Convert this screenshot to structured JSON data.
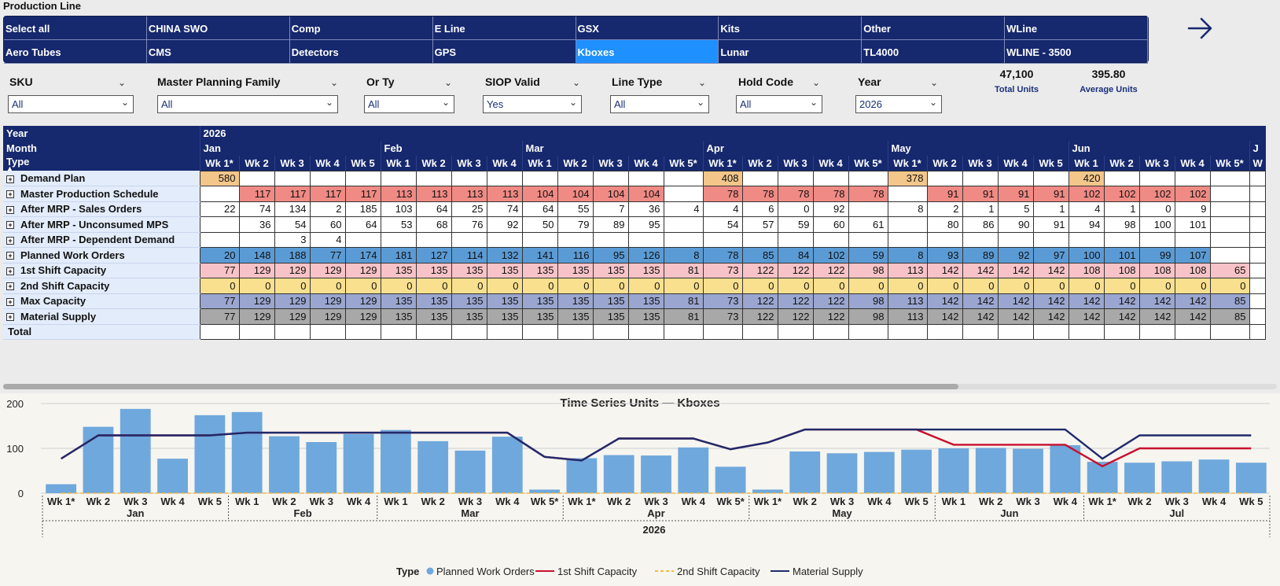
{
  "production_line": {
    "title": "Production Line",
    "tiles": [
      "Select all",
      "CHINA SWO",
      "Comp",
      "E Line",
      "GSX",
      "Kits",
      "Other",
      "WLine",
      "Aero Tubes",
      "CMS",
      "Detectors",
      "GPS",
      "Kboxes",
      "Lunar",
      "TL4000",
      "WLINE - 3500"
    ],
    "selected": "Kboxes"
  },
  "filters": [
    {
      "label": "SKU",
      "value": "All"
    },
    {
      "label": "Master Planning Family",
      "value": "All"
    },
    {
      "label": "Or Ty",
      "value": "All"
    },
    {
      "label": "SIOP Valid",
      "value": "Yes"
    },
    {
      "label": "Line Type",
      "value": "All"
    },
    {
      "label": "Hold Code",
      "value": "All"
    },
    {
      "label": "Year",
      "value": "2026"
    }
  ],
  "kpis": [
    {
      "value": "47,100",
      "label": "Total Units"
    },
    {
      "value": "395.80",
      "label": "Average Units"
    }
  ],
  "matrix": {
    "year_label": "Year",
    "month_label": "Month",
    "type_label": "Type",
    "sort_indicator": "▲",
    "year": "2026",
    "months": [
      {
        "name": "Jan",
        "span": 5
      },
      {
        "name": "Feb",
        "span": 4
      },
      {
        "name": "Mar",
        "span": 5
      },
      {
        "name": "Apr",
        "span": 5
      },
      {
        "name": "May",
        "span": 5
      },
      {
        "name": "Jun",
        "span": 5
      },
      {
        "name": "J",
        "span": 1
      }
    ],
    "weeks": [
      "Wk 1*",
      "Wk 2",
      "Wk 3",
      "Wk 4",
      "Wk 5",
      "Wk 1",
      "Wk 2",
      "Wk 3",
      "Wk 4",
      "Wk 1",
      "Wk 2",
      "Wk 3",
      "Wk 4",
      "Wk 5*",
      "Wk 1*",
      "Wk 2",
      "Wk 3",
      "Wk 4",
      "Wk 5*",
      "Wk 1*",
      "Wk 2",
      "Wk 3",
      "Wk 4",
      "Wk 5",
      "Wk 1",
      "Wk 2",
      "Wk 3",
      "Wk 4",
      "Wk 5*",
      "W"
    ],
    "rows": [
      {
        "label": "Demand Plan",
        "bg": "#f3c68a",
        "cells": [
          "580",
          "",
          "",
          "",
          "",
          "",
          "",
          "",
          "",
          "",
          "",
          "",
          "",
          "",
          "408",
          "",
          "",
          "",
          "",
          "378",
          "",
          "",
          "",
          "",
          "420",
          "",
          "",
          "",
          "",
          ""
        ]
      },
      {
        "label": "Master Production Schedule",
        "bg": "#f08a84",
        "cells": [
          "",
          "117",
          "117",
          "117",
          "117",
          "113",
          "113",
          "113",
          "113",
          "104",
          "104",
          "104",
          "104",
          "",
          "78",
          "78",
          "78",
          "78",
          "78",
          "",
          "91",
          "91",
          "91",
          "91",
          "102",
          "102",
          "102",
          "102",
          "",
          ""
        ]
      },
      {
        "label": "After MRP - Sales Orders",
        "bg": "",
        "cells": [
          "22",
          "74",
          "134",
          "2",
          "185",
          "103",
          "64",
          "25",
          "74",
          "64",
          "55",
          "7",
          "36",
          "4",
          "4",
          "6",
          "0",
          "92",
          "",
          "8",
          "2",
          "1",
          "5",
          "1",
          "4",
          "1",
          "0",
          "9",
          "",
          ""
        ]
      },
      {
        "label": "After MRP - Unconsumed MPS",
        "bg": "",
        "cells": [
          "",
          "36",
          "54",
          "60",
          "64",
          "53",
          "68",
          "76",
          "92",
          "50",
          "79",
          "89",
          "95",
          "",
          "54",
          "57",
          "59",
          "60",
          "61",
          "",
          "80",
          "86",
          "90",
          "91",
          "94",
          "98",
          "100",
          "101",
          "",
          ""
        ]
      },
      {
        "label": "After MRP - Dependent Demand",
        "bg": "",
        "cells": [
          "",
          "",
          "3",
          "4",
          "",
          "",
          "",
          "",
          "",
          "",
          "",
          "",
          "",
          "",
          "",
          "",
          "",
          "",
          "",
          "",
          "",
          "",
          "",
          "",
          "",
          "",
          "",
          "",
          "",
          ""
        ]
      },
      {
        "label": "Planned Work Orders",
        "bg": "#5b9bd5",
        "cells": [
          "20",
          "148",
          "188",
          "77",
          "174",
          "181",
          "127",
          "114",
          "132",
          "141",
          "116",
          "95",
          "126",
          "8",
          "78",
          "85",
          "84",
          "102",
          "59",
          "8",
          "93",
          "89",
          "92",
          "97",
          "100",
          "101",
          "99",
          "107",
          "",
          ""
        ]
      },
      {
        "label": "1st Shift Capacity",
        "bg": "#f8c3c8",
        "cells": [
          "77",
          "129",
          "129",
          "129",
          "129",
          "135",
          "135",
          "135",
          "135",
          "135",
          "135",
          "135",
          "135",
          "81",
          "73",
          "122",
          "122",
          "122",
          "98",
          "113",
          "142",
          "142",
          "142",
          "142",
          "108",
          "108",
          "108",
          "108",
          "65",
          ""
        ]
      },
      {
        "label": "2nd Shift Capacity",
        "bg": "#f9e08e",
        "cells": [
          "0",
          "0",
          "0",
          "0",
          "0",
          "0",
          "0",
          "0",
          "0",
          "0",
          "0",
          "0",
          "0",
          "0",
          "0",
          "0",
          "0",
          "0",
          "0",
          "0",
          "0",
          "0",
          "0",
          "0",
          "0",
          "0",
          "0",
          "0",
          "0",
          ""
        ]
      },
      {
        "label": "Max Capacity",
        "bg": "#9aa6cf",
        "cells": [
          "77",
          "129",
          "129",
          "129",
          "129",
          "135",
          "135",
          "135",
          "135",
          "135",
          "135",
          "135",
          "135",
          "81",
          "73",
          "122",
          "122",
          "122",
          "98",
          "113",
          "142",
          "142",
          "142",
          "142",
          "142",
          "142",
          "142",
          "142",
          "85",
          ""
        ]
      },
      {
        "label": "Material Supply",
        "bg": "#a8a8a8",
        "cells": [
          "77",
          "129",
          "129",
          "129",
          "129",
          "135",
          "135",
          "135",
          "135",
          "135",
          "135",
          "135",
          "135",
          "81",
          "73",
          "122",
          "122",
          "122",
          "98",
          "113",
          "142",
          "142",
          "142",
          "142",
          "142",
          "142",
          "142",
          "142",
          "85",
          ""
        ]
      },
      {
        "label": "Total",
        "bg": "",
        "total": true,
        "cells": [
          "",
          "",
          "",
          "",
          "",
          "",
          "",
          "",
          "",
          "",
          "",
          "",
          "",
          "",
          "",
          "",
          "",
          "",
          "",
          "",
          "",
          "",
          "",
          "",
          "",
          "",
          "",
          "",
          "",
          ""
        ]
      }
    ]
  },
  "chart_data": {
    "type": "bar",
    "title": "Time Series Units — Kboxes",
    "ylim": [
      0,
      215
    ],
    "yticks": [
      "0",
      "100",
      "200"
    ],
    "categories": [
      "Wk 1*",
      "Wk 2",
      "Wk 3",
      "Wk 4",
      "Wk 5",
      "Wk 1",
      "Wk 2",
      "Wk 3",
      "Wk 4",
      "Wk 1",
      "Wk 2",
      "Wk 3",
      "Wk 4",
      "Wk 5*",
      "Wk 1*",
      "Wk 2",
      "Wk 3",
      "Wk 4",
      "Wk 5*",
      "Wk 1*",
      "Wk 2",
      "Wk 3",
      "Wk 4",
      "Wk 5",
      "Wk 1",
      "Wk 2",
      "Wk 3",
      "Wk 4",
      "Wk 1*",
      "Wk 2",
      "Wk 3",
      "Wk 4",
      "Wk 5"
    ],
    "months": [
      {
        "name": "Jan",
        "span": 5
      },
      {
        "name": "Feb",
        "span": 4
      },
      {
        "name": "Mar",
        "span": 5
      },
      {
        "name": "Apr",
        "span": 5
      },
      {
        "name": "May",
        "span": 5
      },
      {
        "name": "Jun",
        "span": 4
      },
      {
        "name": "Jul",
        "span": 5
      }
    ],
    "year": "2026",
    "legend_title": "Type",
    "series": [
      {
        "name": "Planned Work Orders",
        "kind": "bar",
        "color": "#6fa8dc",
        "values": [
          20,
          148,
          188,
          77,
          174,
          181,
          127,
          114,
          132,
          141,
          116,
          95,
          126,
          8,
          78,
          85,
          84,
          102,
          59,
          8,
          93,
          89,
          92,
          97,
          100,
          101,
          99,
          107,
          70,
          68,
          71,
          75,
          68
        ]
      },
      {
        "name": "1st Shift Capacity",
        "kind": "line",
        "color": "#c8102e",
        "values": [
          77,
          129,
          129,
          129,
          129,
          135,
          135,
          135,
          135,
          135,
          135,
          135,
          135,
          81,
          73,
          122,
          122,
          122,
          98,
          113,
          142,
          142,
          142,
          142,
          108,
          108,
          108,
          108,
          60,
          100,
          100,
          100,
          100
        ]
      },
      {
        "name": "2nd Shift Capacity",
        "kind": "dashed",
        "color": "#f4b942",
        "values": [
          0,
          0,
          0,
          0,
          0,
          0,
          0,
          0,
          0,
          0,
          0,
          0,
          0,
          0,
          0,
          0,
          0,
          0,
          0,
          0,
          0,
          0,
          0,
          0,
          0,
          0,
          0,
          0,
          0,
          0,
          0,
          0,
          0
        ]
      },
      {
        "name": "Material Supply",
        "kind": "line",
        "color": "#1f2a6b",
        "values": [
          77,
          129,
          129,
          129,
          129,
          135,
          135,
          135,
          135,
          135,
          135,
          135,
          135,
          81,
          73,
          122,
          122,
          122,
          98,
          113,
          142,
          142,
          142,
          142,
          142,
          142,
          142,
          142,
          77,
          129,
          129,
          129,
          129
        ]
      }
    ]
  }
}
